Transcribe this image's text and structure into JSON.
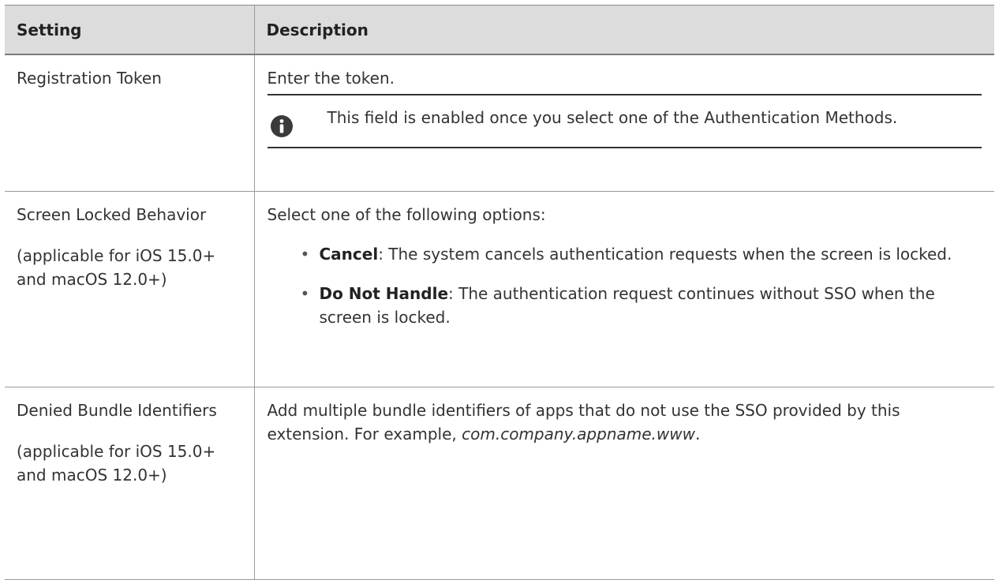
{
  "table": {
    "header": {
      "setting": "Setting",
      "description": "Description"
    },
    "rows": [
      {
        "setting": "Registration Token",
        "description": "Enter the token.",
        "note": {
          "icon": "info-icon",
          "icon_color": "#3a3a3a",
          "text": "This field is enabled once you select one of the Authentication Methods."
        }
      },
      {
        "setting": "Screen Locked Behavior",
        "applicability": "(applicable for iOS 15.0+ and macOS 12.0+)",
        "intro": "Select one of the following options:",
        "options": [
          {
            "term": "Cancel",
            "text": ": The system cancels authentication requests when the screen is locked."
          },
          {
            "term": "Do Not Handle",
            "text": ": The authentication request continues without SSO when the screen is locked."
          }
        ]
      },
      {
        "setting": "Denied Bundle Identifiers",
        "applicability": "(applicable for iOS 15.0+ and macOS 12.0+)",
        "description": "Add multiple bundle identifiers of apps that do not use the SSO provided by this extension. For example, ",
        "example": "com.company.appname.www",
        "example_suffix": "."
      }
    ]
  },
  "colors": {
    "header_bg": "#dcdcdc",
    "border": "#9a9a9a",
    "text": "#333333"
  }
}
